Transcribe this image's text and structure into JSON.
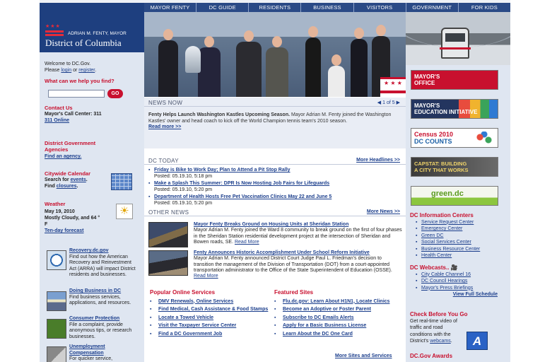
{
  "nav": [
    "MAYOR FENTY",
    "DC GUIDE",
    "RESIDENTS",
    "BUSINESS",
    "VISITORS",
    "GOVERNMENT",
    "FOR KIDS"
  ],
  "logo": {
    "mayor": "ADRIAN M. FENTY, MAYOR",
    "district": "District of Columbia"
  },
  "welcome": {
    "line1": "Welcome to DC.Gov.",
    "please": "Please",
    "login": "login",
    "or": "or",
    "register": "register",
    "end": "."
  },
  "search": {
    "heading": "What can we help you find?",
    "button": "GO",
    "placeholder": ""
  },
  "contact": {
    "heading": "Contact Us",
    "call_center": "Mayor's Call Center: 311",
    "online": "311 Online"
  },
  "agencies": {
    "heading": "District Government Agencies",
    "link": "Find an agency."
  },
  "calendar": {
    "heading": "Citywide Calendar",
    "search": "Search for",
    "events": "events",
    "find": "Find",
    "closures": "closures",
    "dot": "."
  },
  "weather": {
    "heading": "Weather",
    "date": "May 19, 2010",
    "forecast": "Mostly Cloudy, and 64 °",
    "unit": "F",
    "link": "Ten-day forecast"
  },
  "left_features": [
    {
      "title": "Recovery.dc.gov",
      "desc": "Find out how the American Recovery and Reinvestment Act (ARRA) will impact District residents and businesses."
    },
    {
      "title": "Doing Business in DC",
      "desc": "Find business services, applications, and resources."
    },
    {
      "title": "Consumer Protection",
      "desc": "File a complaint, provide anonymous tips, or research businesses."
    },
    {
      "title": "Unemployment Compensation",
      "desc": "For quicker service,"
    }
  ],
  "news": {
    "heading": "NEWS NOW",
    "pager": "1 of 5",
    "title": "Fenty Helps Launch Washington Kastles Upcoming Season.",
    "body": "Mayor Adrian M. Fenty joined the Washington Kastles' owner and head coach to kick off the World Champion tennis team's 2010 season.",
    "more": "Read more >>"
  },
  "today": {
    "heading": "DC TODAY",
    "more": "More Headlines >>",
    "items": [
      {
        "title": "Friday is Bike to Work Day; Plan to Attend a Pit Stop Rally",
        "posted": "Posted: 05.19.10, 5:18 pm"
      },
      {
        "title": "Make a Splash This Summer: DPR Is Now Hosting Job Fairs for Lifeguards",
        "posted": "Posted: 05.19.10, 5:20 pm"
      },
      {
        "title": "Department of Health Hosts Free Pet Vaccination Clinics May 22 and June 5",
        "posted": "Posted: 05.19.10, 5:20 pm"
      }
    ]
  },
  "other_news": {
    "heading": "OTHER NEWS",
    "more": "More News >>",
    "items": [
      {
        "title": "Mayor Fenty Breaks Ground on Housing Units at Sheridan Station",
        "body": "Mayor Adrian M. Fenty joined the Ward 8 community to break ground on the first of four phases in the Sheridan Station residential development project at the intersection of Sheridan and Bowen roads, SE.",
        "more": "Read More"
      },
      {
        "title": "Fenty Announces Historic Accomplishment Under School Reform Initiative",
        "body": "Mayor Adrian M. Fenty announced District Court Judge Paul L. Friedman's decision to transition the management of the Division of Transportation (DOT) from a court-appointed transportation administrator to the Office of the State Superintendent of Education (OSSE).",
        "more": "Read More"
      }
    ]
  },
  "popular": {
    "heading": "Popular Online Services",
    "items": [
      "DMV Renewals, Online Services",
      "Find Medical, Cash Assistance & Food Stamps",
      "Locate a Towed Vehicle",
      "Visit the Taxpayer Service Center",
      "Find a DC Government Job"
    ]
  },
  "featured": {
    "heading": "Featured Sites",
    "items": [
      "Flu.dc.gov: Learn About H1N1, Locate Clinics",
      "Become an Adoptive or Foster Parent",
      "Subscribe to DC Emails Alerts",
      "Apply for a Basic Business License",
      "Learn About the DC One Card"
    ],
    "more": "More Sites and Services"
  },
  "right_banners": [
    {
      "line1": "MAYOR'S",
      "line2": "OFFICE"
    },
    {
      "line1": "MAYOR'S",
      "line2": "EDUCATION INITIATIVE"
    },
    {
      "line1": "Census 2010",
      "line2": "DC COUNTS"
    },
    {
      "line1": "CAPSTAT: BUILDING",
      "line2": "A CITY THAT WORKS"
    },
    {
      "line1": "green.dc",
      "line2": ""
    }
  ],
  "info_centers": {
    "heading": "DC Information Centers",
    "items": [
      "Service Request Center",
      "Emergency Center",
      "Green DC",
      "Social Services Center",
      "Business Resource Center",
      "Health Center"
    ]
  },
  "webcasts": {
    "heading": "DC Webcasts..",
    "items": [
      "City Cable Channel 16",
      "DC Council Hearings",
      "Mayor's Press Briefings"
    ],
    "more": "View Full Schedule"
  },
  "check_before": {
    "heading": "Check Before You Go",
    "body": "Get real-time video of traffic and road conditions with the District's",
    "link": "webcams",
    "end": "."
  },
  "awards": {
    "heading": "DC.Gov Awards"
  }
}
